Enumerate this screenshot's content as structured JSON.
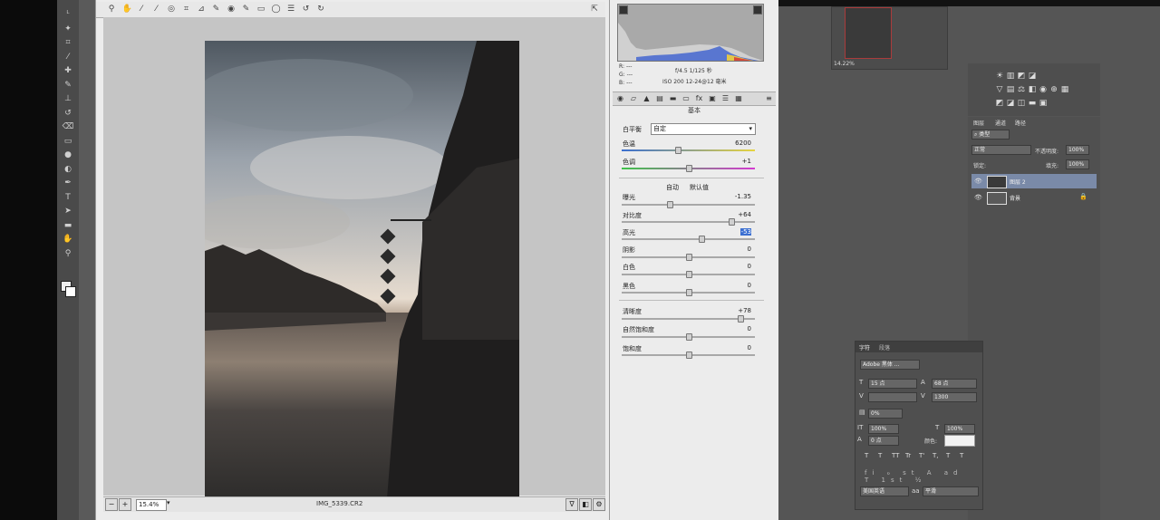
{
  "toolbar": {
    "tools": [
      "lasso-icon",
      "magic-wand-icon",
      "crop-icon",
      "eyedropper-icon",
      "spot-healing-icon",
      "brush-icon",
      "clone-stamp-icon",
      "history-brush-icon",
      "eraser-icon",
      "gradient-icon",
      "blur-icon",
      "dodge-icon",
      "pen-icon",
      "type-icon",
      "path-select-icon",
      "rectangle-icon",
      "hand-icon",
      "zoom-icon"
    ]
  },
  "camera_raw": {
    "top_tools": [
      "zoom-icon",
      "hand-icon",
      "white-balance-icon",
      "color-sampler-icon",
      "target-adjust-icon",
      "crop-icon",
      "straighten-icon",
      "spot-removal-icon",
      "red-eye-icon",
      "adjustment-brush-icon",
      "graduated-filter-icon",
      "radial-filter-icon",
      "preferences-icon",
      "rotate-left-icon",
      "rotate-right-icon"
    ],
    "preview": {
      "zoom_value": "15.4%",
      "filename": "IMG_5339.CR2"
    },
    "info": {
      "r_label": "R:",
      "r_value": "---",
      "g_label": "G:",
      "g_value": "---",
      "b_label": "B:",
      "b_value": "---",
      "exposure": "f/4.5  1/125 秒",
      "iso": "ISO 200  12-24@12 毫米"
    },
    "panel_title": "基本",
    "white_balance": {
      "label": "白平衡",
      "value": "自定"
    },
    "auto_label": "自动",
    "default_label": "默认值",
    "sliders": [
      {
        "label": "色温",
        "value": "6200",
        "pos": 0.42
      },
      {
        "label": "色调",
        "value": "+1",
        "pos": 0.5
      },
      {
        "label": "曝光",
        "value": "-1.35",
        "pos": 0.36
      },
      {
        "label": "对比度",
        "value": "+64",
        "pos": 0.82
      },
      {
        "label": "高光",
        "value": "-53",
        "pos": 0.6
      },
      {
        "label": "阴影",
        "value": "0",
        "pos": 0.5
      },
      {
        "label": "白色",
        "value": "0",
        "pos": 0.5
      },
      {
        "label": "黑色",
        "value": "0",
        "pos": 0.5
      },
      {
        "label": "清晰度",
        "value": "+78",
        "pos": 0.89
      },
      {
        "label": "自然饱和度",
        "value": "0",
        "pos": 0.5
      },
      {
        "label": "饱和度",
        "value": "0",
        "pos": 0.5
      }
    ]
  },
  "navigator": {
    "zoom": "14.22%"
  },
  "layers": {
    "tabs": [
      "图层",
      "通道",
      "路径"
    ],
    "filter_label": "类型",
    "blend_mode": "正常",
    "opacity_label": "不透明度:",
    "opacity_value": "100%",
    "lock_label": "锁定:",
    "fill_label": "填充:",
    "fill_value": "100%",
    "items": [
      {
        "name": "图层 2",
        "selected": true
      },
      {
        "name": "背景",
        "selected": false
      }
    ]
  },
  "character": {
    "tabs": [
      "字符",
      "段落"
    ],
    "font_family": "Adobe 黑体 ...",
    "font_size": "15 点",
    "leading": "68 点",
    "kerning": "",
    "tracking": "1300",
    "scale_pct": "0%",
    "vertical_scale": "100%",
    "horizontal_scale": "100%",
    "baseline": "0 点",
    "color_label": "颜色:",
    "style_buttons": [
      "T",
      "T",
      "TT",
      "Tr",
      "T'",
      "T,",
      "T",
      "T"
    ],
    "language": "美国英语",
    "aa_label": "aa",
    "aa_value": "平滑"
  }
}
